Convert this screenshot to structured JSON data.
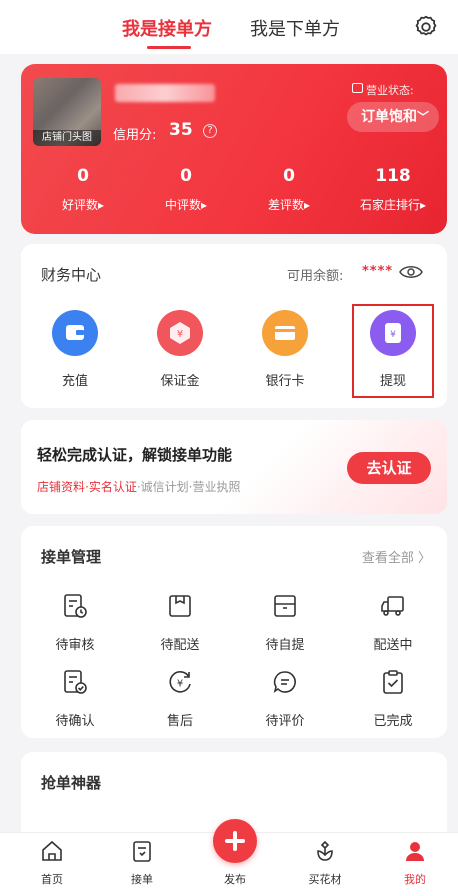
{
  "top_tabs": {
    "active": "我是接单方",
    "inactive": "我是下单方"
  },
  "store": {
    "avatar_caption": "店铺门头图",
    "credit_label": "信用分:",
    "credit_value": "35",
    "biz_status_label": "营业状态:",
    "biz_status_value": "订单饱和",
    "stats": [
      {
        "value": "0",
        "label": "好评数▸"
      },
      {
        "value": "0",
        "label": "中评数▸"
      },
      {
        "value": "0",
        "label": "差评数▸"
      },
      {
        "value": "118",
        "label": "石家庄排行▸"
      }
    ]
  },
  "finance": {
    "title": "财务中心",
    "balance_label": "可用余额:",
    "balance_mask": "****",
    "items": [
      {
        "label": "充值",
        "color": "#3b82f0"
      },
      {
        "label": "保证金",
        "color": "#f0565c"
      },
      {
        "label": "银行卡",
        "color": "#f6a13a"
      },
      {
        "label": "提现",
        "color": "#8b5cf0"
      }
    ]
  },
  "cert": {
    "title": "轻松完成认证，解锁接单功能",
    "sub_hl": "店铺资料·实名认证",
    "sub_rest": "·诚信计划·营业执照",
    "button": "去认证"
  },
  "orders": {
    "title": "接单管理",
    "view_all": "查看全部 〉",
    "items": [
      "待审核",
      "待配送",
      "待自提",
      "配送中",
      "待确认",
      "售后",
      "待评价",
      "已完成"
    ]
  },
  "grab": {
    "title": "抢单神器"
  },
  "nav": {
    "items": [
      "首页",
      "接单",
      "发布",
      "买花材",
      "我的"
    ]
  },
  "colors": {
    "accent": "#e8323c"
  }
}
